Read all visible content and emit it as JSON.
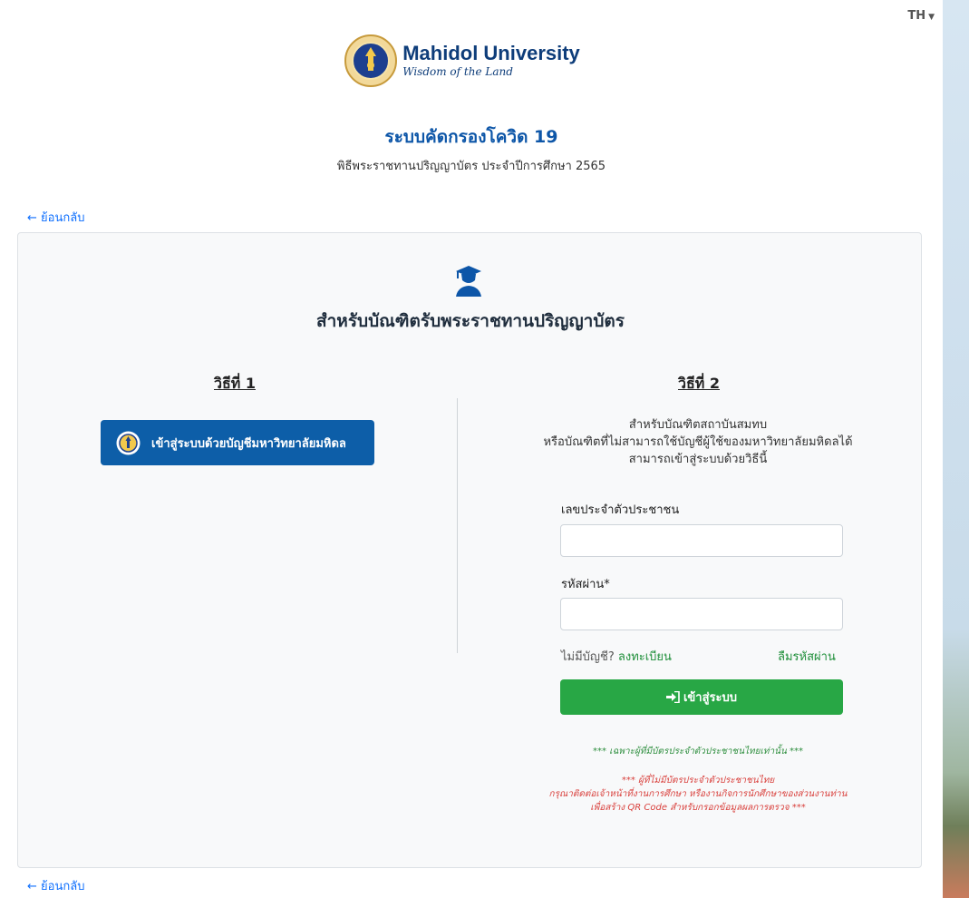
{
  "lang_switch": {
    "label": "TH"
  },
  "brand": {
    "name": "Mahidol University",
    "tagline": "Wisdom of the Land"
  },
  "page": {
    "title": "ระบบคัดกรองโควิด 19",
    "subtitle": "พิธีพระราชทานปริญญาบัตร ประจำปีการศึกษา 2565",
    "back_label": "ย้อนกลับ"
  },
  "card": {
    "title": "สำหรับบัณฑิตรับพระราชทานปริญญาบัตร",
    "method1": {
      "heading": "วิธีที่ 1",
      "sso_button": "เข้าสู่ระบบด้วยบัญชีมหาวิทยาลัยมหิดล"
    },
    "method2": {
      "heading": "วิธีที่ 2",
      "desc_line1": "สำหรับบัณฑิตสถาบันสมทบ",
      "desc_line2": "หรือบัณฑิตที่ไม่สามารถใช้บัญชีผู้ใช้ของมหาวิทยาลัยมหิดลได้",
      "desc_line3": "สามารถเข้าสู่ระบบด้วยวิธีนี้",
      "id_label": "เลขประจำตัวประชาชน",
      "id_value": "",
      "password_label": "รหัสผ่าน*",
      "password_value": "",
      "no_account": "ไม่มีบัญชี?",
      "register": "ลงทะเบียน",
      "forgot": "ลืมรหัสผ่าน",
      "login_button": "เข้าสู่ระบบ",
      "note_green": "*** เฉพาะผู้ที่มีบัตรประจำตัวประชาชนไทยเท่านั้น ***",
      "note_red_1": "*** ผู้ที่ไม่มีบัตรประจำตัวประชาชนไทย",
      "note_red_2": "กรุณาติดต่อเจ้าหน้าที่งานการศึกษา หรืองานกิจการนักศึกษาของส่วนงานท่าน",
      "note_red_3": "เพื่อสร้าง QR Code สำหรับกรอกข้อมูลผลการตรวจ ***"
    }
  },
  "colors": {
    "primary": "#0d56a8",
    "sso_button": "#0d5ea8",
    "login_button": "#28a745",
    "link_green": "#1f8f3a",
    "note_red": "#d9413d"
  }
}
